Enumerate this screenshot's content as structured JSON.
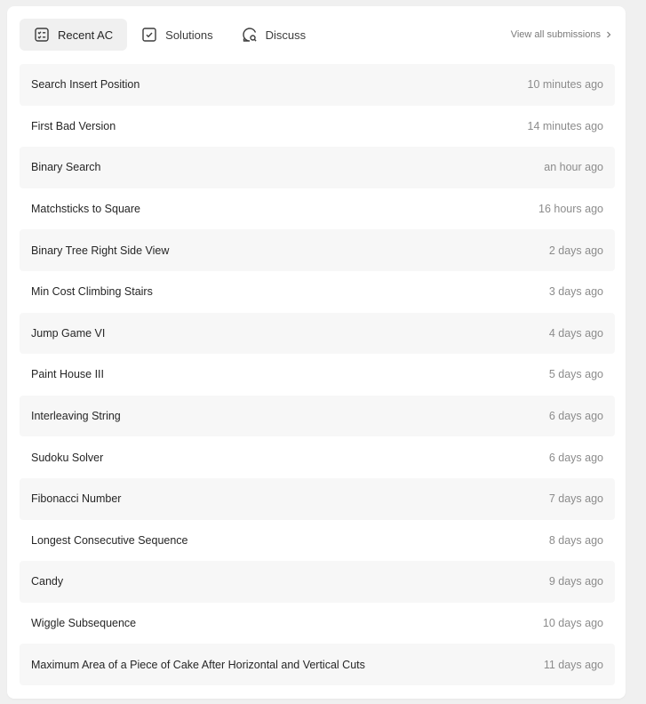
{
  "tabs": [
    {
      "label": "Recent AC",
      "icon": "list-check-icon",
      "active": true
    },
    {
      "label": "Solutions",
      "icon": "checkbox-icon",
      "active": false
    },
    {
      "label": "Discuss",
      "icon": "chat-search-icon",
      "active": false
    }
  ],
  "view_all": {
    "label": "View all submissions",
    "icon": "chevron-right-icon"
  },
  "submissions": [
    {
      "title": "Search Insert Position",
      "time": "10 minutes ago"
    },
    {
      "title": "First Bad Version",
      "time": "14 minutes ago"
    },
    {
      "title": "Binary Search",
      "time": "an hour ago"
    },
    {
      "title": "Matchsticks to Square",
      "time": "16 hours ago"
    },
    {
      "title": "Binary Tree Right Side View",
      "time": "2 days ago"
    },
    {
      "title": "Min Cost Climbing Stairs",
      "time": "3 days ago"
    },
    {
      "title": "Jump Game VI",
      "time": "4 days ago"
    },
    {
      "title": "Paint House III",
      "time": "5 days ago"
    },
    {
      "title": "Interleaving String",
      "time": "6 days ago"
    },
    {
      "title": "Sudoku Solver",
      "time": "6 days ago"
    },
    {
      "title": "Fibonacci Number",
      "time": "7 days ago"
    },
    {
      "title": "Longest Consecutive Sequence",
      "time": "8 days ago"
    },
    {
      "title": "Candy",
      "time": "9 days ago"
    },
    {
      "title": "Wiggle Subsequence",
      "time": "10 days ago"
    },
    {
      "title": "Maximum Area of a Piece of Cake After Horizontal and Vertical Cuts",
      "time": "11 days ago"
    }
  ]
}
